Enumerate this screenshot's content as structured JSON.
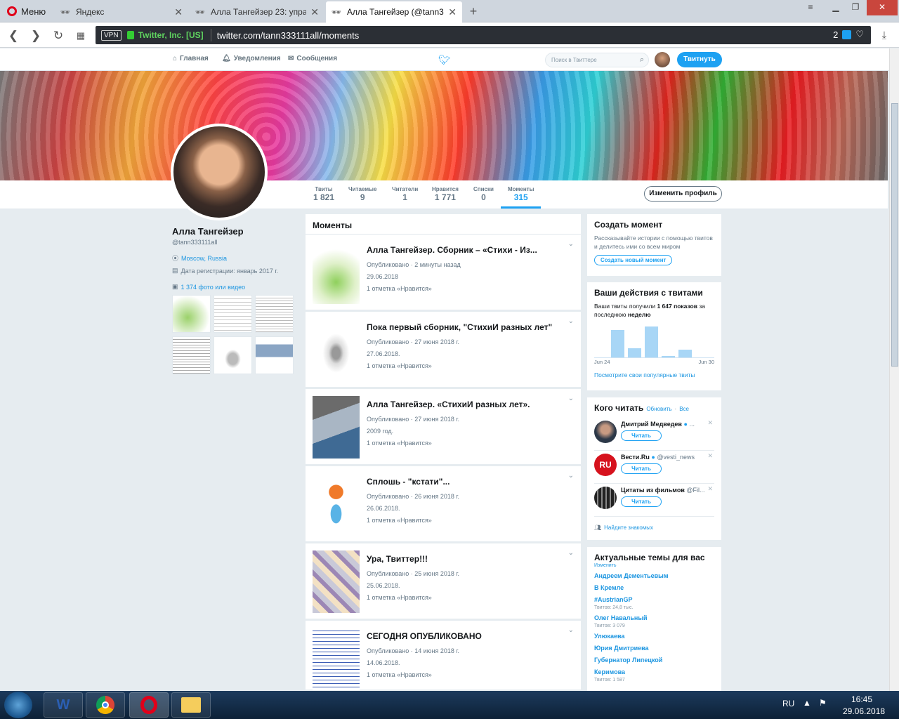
{
  "browser": {
    "menu_label": "Меню",
    "tabs": [
      {
        "title": "Яндекс"
      },
      {
        "title": "Алла Тангейзер 23: управ"
      },
      {
        "title": "Алла Тангейзер (@tann33"
      }
    ],
    "vpn_label": "VPN",
    "cert": "Twitter, Inc. [US]",
    "url": "twitter.com/tann333111all/moments",
    "badge_count": "2"
  },
  "twitter_nav": {
    "home": "Главная",
    "notifications": "Уведомления",
    "messages": "Сообщения",
    "search_placeholder": "Поиск в Твиттере",
    "tweet_button": "Твитнуть"
  },
  "profile": {
    "name": "Алла Тангейзер",
    "handle": "@tann333111all",
    "location": "Moscow, Russia",
    "joined": "Дата регистрации: январь 2017 г.",
    "media_link": "1 374 фото или видео",
    "edit_button": "Изменить профиль",
    "stats": [
      {
        "label": "Твиты",
        "value": "1 821"
      },
      {
        "label": "Читаемые",
        "value": "9"
      },
      {
        "label": "Читатели",
        "value": "1"
      },
      {
        "label": "Нравится",
        "value": "1 771"
      },
      {
        "label": "Списки",
        "value": "0"
      },
      {
        "label": "Моменты",
        "value": "315"
      }
    ]
  },
  "moments": {
    "header": "Моменты",
    "items": [
      {
        "title": "Алла Тангейзер. Сборник – «Стихи - Из...",
        "published": "Опубликовано · 2 минуты назад",
        "date": "29.06.2018",
        "likes": "1 отметка «Нравится»"
      },
      {
        "title": "Пока первый сборник, \"СтихиИ разных лет\"",
        "published": "Опубликовано · 27 июня 2018 г.",
        "date": "27.06.2018.",
        "likes": "1 отметка «Нравится»"
      },
      {
        "title": "Алла Тангейзер. «СтихиИ разных лет».",
        "published": "Опубликовано · 27 июня 2018 г.",
        "date": "2009 год.",
        "likes": "1 отметка «Нравится»"
      },
      {
        "title": "Сплошь - \"кстати\"...",
        "published": "Опубликовано · 26 июня 2018 г.",
        "date": "26.06.2018.",
        "likes": "1 отметка «Нравится»"
      },
      {
        "title": "Ура, Твиттер!!!",
        "published": "Опубликовано · 25 июня 2018 г.",
        "date": "25.06.2018.",
        "likes": "1 отметка «Нравится»"
      },
      {
        "title": "СЕГОДНЯ ОПУБЛИКОВАНО",
        "published": "Опубликовано · 14 июня 2018 г.",
        "date": "14.06.2018.",
        "likes": "1 отметка «Нравится»"
      }
    ]
  },
  "create_moment": {
    "title": "Создать момент",
    "text": "Рассказывайте истории с помощью твитов и делитесь ими со всем миром",
    "button": "Создать новый момент"
  },
  "activity": {
    "title": "Ваши действия с твитами",
    "text_prefix": "Ваши твиты получили",
    "impressions": "1 647 показов",
    "text_mid": "за последнюю",
    "period": "неделю",
    "x_start": "Jun 24",
    "x_end": "Jun 30",
    "link": "Посмотрите свои популярные твиты",
    "chart_values": [
      0.0,
      0.82,
      0.28,
      0.92,
      0.04,
      0.22,
      0.0
    ]
  },
  "who_to_follow": {
    "title": "Кого читать",
    "refresh": "Обновить",
    "all": "Все",
    "follow_label": "Читать",
    "people": [
      {
        "name": "Дмитрий Медведев",
        "handle": "..."
      },
      {
        "name": "Вести.Ru",
        "handle": "@vesti_news"
      },
      {
        "name": "Цитаты из фильмов",
        "handle": "@Fil..."
      }
    ],
    "find_friends": "Найдите знакомых"
  },
  "trends": {
    "title": "Актуальные темы для вас",
    "change": "Изменить",
    "items": [
      {
        "name": "Андреем Дементьевым",
        "count": ""
      },
      {
        "name": "В Кремле",
        "count": ""
      },
      {
        "name": "#AustrianGP",
        "count": "Твитов: 24,8 тыс."
      },
      {
        "name": "Олег Навальный",
        "count": "Твитов: 3 079"
      },
      {
        "name": "Улюкаева",
        "count": ""
      },
      {
        "name": "Юрия Дмитриева",
        "count": ""
      },
      {
        "name": "Губернатор Липецкой",
        "count": ""
      },
      {
        "name": "Керимова",
        "count": "Твитов: 1 587"
      }
    ]
  },
  "taskbar": {
    "lang": "RU",
    "time": "16:45",
    "date": "29.06.2018"
  }
}
